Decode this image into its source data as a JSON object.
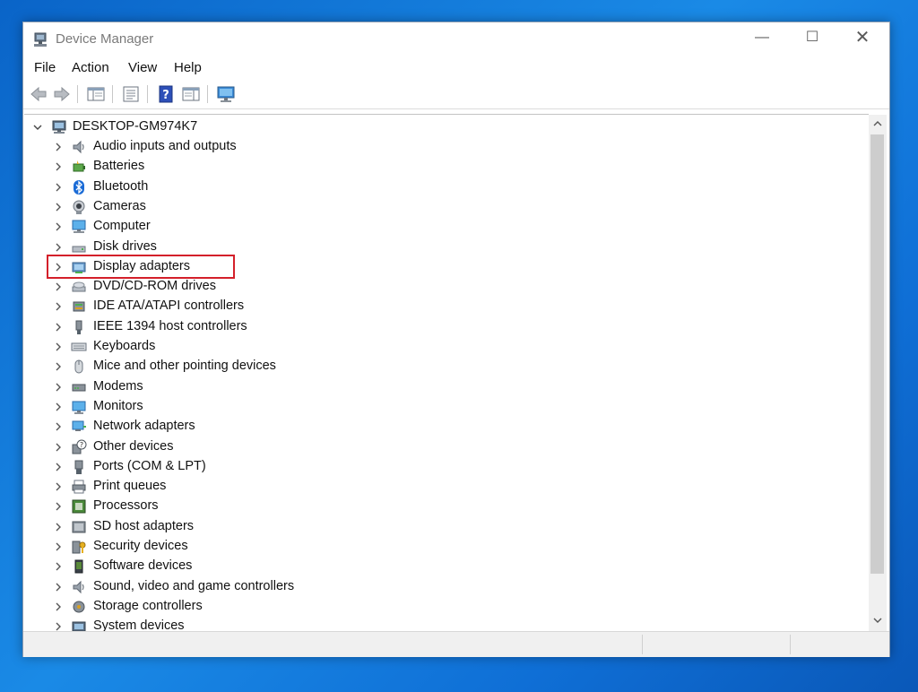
{
  "window": {
    "title": "Device Manager"
  },
  "controls": {
    "minimize": "—",
    "maximize": "☐",
    "close": "✕"
  },
  "menu": [
    {
      "label": "File"
    },
    {
      "label": "Action"
    },
    {
      "label": "View"
    },
    {
      "label": "Help"
    }
  ],
  "toolbar": [
    "back-arrow-icon",
    "forward-arrow-icon",
    "show-hide-console-tree-icon",
    "properties-icon",
    "help-icon",
    "action-pane-icon",
    "scan-hardware-monitor-icon"
  ],
  "tree": {
    "root": "DESKTOP-GM974K7",
    "items": [
      {
        "label": "Audio inputs and outputs",
        "icon": "speaker-icon"
      },
      {
        "label": "Batteries",
        "icon": "battery-icon"
      },
      {
        "label": "Bluetooth",
        "icon": "bluetooth-icon"
      },
      {
        "label": "Cameras",
        "icon": "camera-icon"
      },
      {
        "label": "Computer",
        "icon": "computer-icon"
      },
      {
        "label": "Disk drives",
        "icon": "disk-drive-icon"
      },
      {
        "label": "Display adapters",
        "icon": "display-adapter-icon"
      },
      {
        "label": "DVD/CD-ROM drives",
        "icon": "dvd-drive-icon"
      },
      {
        "label": "IDE ATA/ATAPI controllers",
        "icon": "ide-controller-icon"
      },
      {
        "label": "IEEE 1394 host controllers",
        "icon": "ieee1394-icon"
      },
      {
        "label": "Keyboards",
        "icon": "keyboard-icon"
      },
      {
        "label": "Mice and other pointing devices",
        "icon": "mouse-icon"
      },
      {
        "label": "Modems",
        "icon": "modem-icon"
      },
      {
        "label": "Monitors",
        "icon": "monitor-icon"
      },
      {
        "label": "Network adapters",
        "icon": "network-adapter-icon"
      },
      {
        "label": "Other devices",
        "icon": "unknown-device-icon"
      },
      {
        "label": "Ports (COM & LPT)",
        "icon": "port-icon"
      },
      {
        "label": "Print queues",
        "icon": "printer-icon"
      },
      {
        "label": "Processors",
        "icon": "processor-icon"
      },
      {
        "label": "SD host adapters",
        "icon": "sd-card-icon"
      },
      {
        "label": "Security devices",
        "icon": "security-key-icon"
      },
      {
        "label": "Software devices",
        "icon": "software-device-icon"
      },
      {
        "label": "Sound, video and game controllers",
        "icon": "sound-controller-icon"
      },
      {
        "label": "Storage controllers",
        "icon": "storage-controller-icon"
      },
      {
        "label": "System devices",
        "icon": "system-device-icon"
      }
    ]
  },
  "colors": {
    "highlight": "#d4202a",
    "desktop": "#1a8ae6"
  }
}
